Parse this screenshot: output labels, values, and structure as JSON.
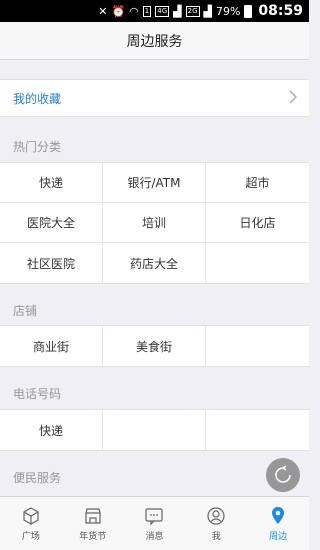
{
  "status_bar": {
    "battery_percent": "79%",
    "time": "08:59",
    "signal_badge": "1",
    "network_4g": "4G",
    "network_2g": "2G"
  },
  "nav": {
    "title": "周边服务"
  },
  "favorites": {
    "label": "我的收藏"
  },
  "sections": [
    {
      "title": "热门分类",
      "rows": [
        [
          "快递",
          "银行/ATM",
          "超市"
        ],
        [
          "医院大全",
          "培训",
          "日化店"
        ],
        [
          "社区医院",
          "药店大全",
          ""
        ]
      ]
    },
    {
      "title": "店铺",
      "rows": [
        [
          "商业街",
          "美食街",
          ""
        ]
      ]
    },
    {
      "title": "电话号码",
      "rows": [
        [
          "快递",
          "",
          ""
        ]
      ]
    },
    {
      "title": "便民服务",
      "rows": []
    }
  ],
  "tabs": [
    {
      "label": "广场",
      "icon": "cube-icon",
      "active": false
    },
    {
      "label": "年货节",
      "icon": "shop-icon",
      "active": false
    },
    {
      "label": "消息",
      "icon": "message-icon",
      "active": false
    },
    {
      "label": "我",
      "icon": "user-icon",
      "active": false
    },
    {
      "label": "周边",
      "icon": "location-pin-icon",
      "active": true
    }
  ],
  "colors": {
    "accent": "#1a8ae0",
    "link": "#2a7fd6"
  }
}
